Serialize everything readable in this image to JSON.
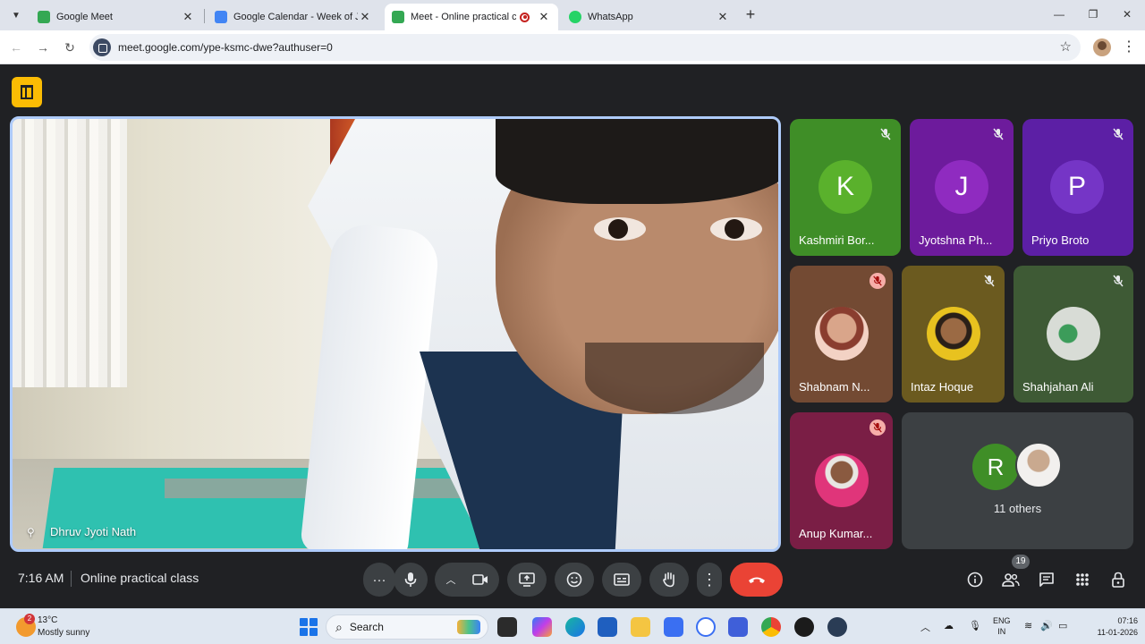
{
  "browser": {
    "tabs": [
      {
        "title": "Google Meet",
        "favicon_color": "#34a853"
      },
      {
        "title": "Google Calendar - Week of Jan",
        "favicon_color": "#4285f4"
      },
      {
        "title": "Meet - Online practical clas",
        "favicon_color": "#34a853",
        "recording": true
      },
      {
        "title": "WhatsApp",
        "favicon_color": "#25d366"
      }
    ],
    "url": "meet.google.com/ype-ksmc-dwe?authuser=0"
  },
  "meet": {
    "presenter_name": "Dhruv Jyoti Nath",
    "participants": [
      {
        "initial": "K",
        "name": "Kashmiri Bor...",
        "bg": "#3f8e27",
        "avatar": "#5ab12c"
      },
      {
        "initial": "J",
        "name": "Jyotshna Ph...",
        "bg": "#6d1b9c",
        "avatar": "#8f2bc0"
      },
      {
        "initial": "P",
        "name": "Priyo Broto",
        "bg": "#5c1fa5",
        "avatar": "#7535c6"
      },
      {
        "name": "Shabnam N...",
        "bg": "#734a33"
      },
      {
        "name": "Intaz Hoque",
        "bg": "#6b5a1f"
      },
      {
        "name": "Shahjahan Ali",
        "bg": "#3e5a35"
      },
      {
        "name": "Anup Kumar...",
        "bg": "#7a1e45"
      }
    ],
    "others": {
      "initial": "R",
      "label": "11 others",
      "avatar": "#3f8e27"
    },
    "clock": "7:16 AM",
    "meeting_name": "Online practical class",
    "participant_count": "19"
  },
  "taskbar": {
    "weather_badge": "2",
    "temperature": "13°C",
    "condition": "Mostly sunny",
    "search_label": "Search",
    "lang_line1": "ENG",
    "lang_line2": "IN",
    "time": "07:16",
    "date": "11-01-2026"
  }
}
